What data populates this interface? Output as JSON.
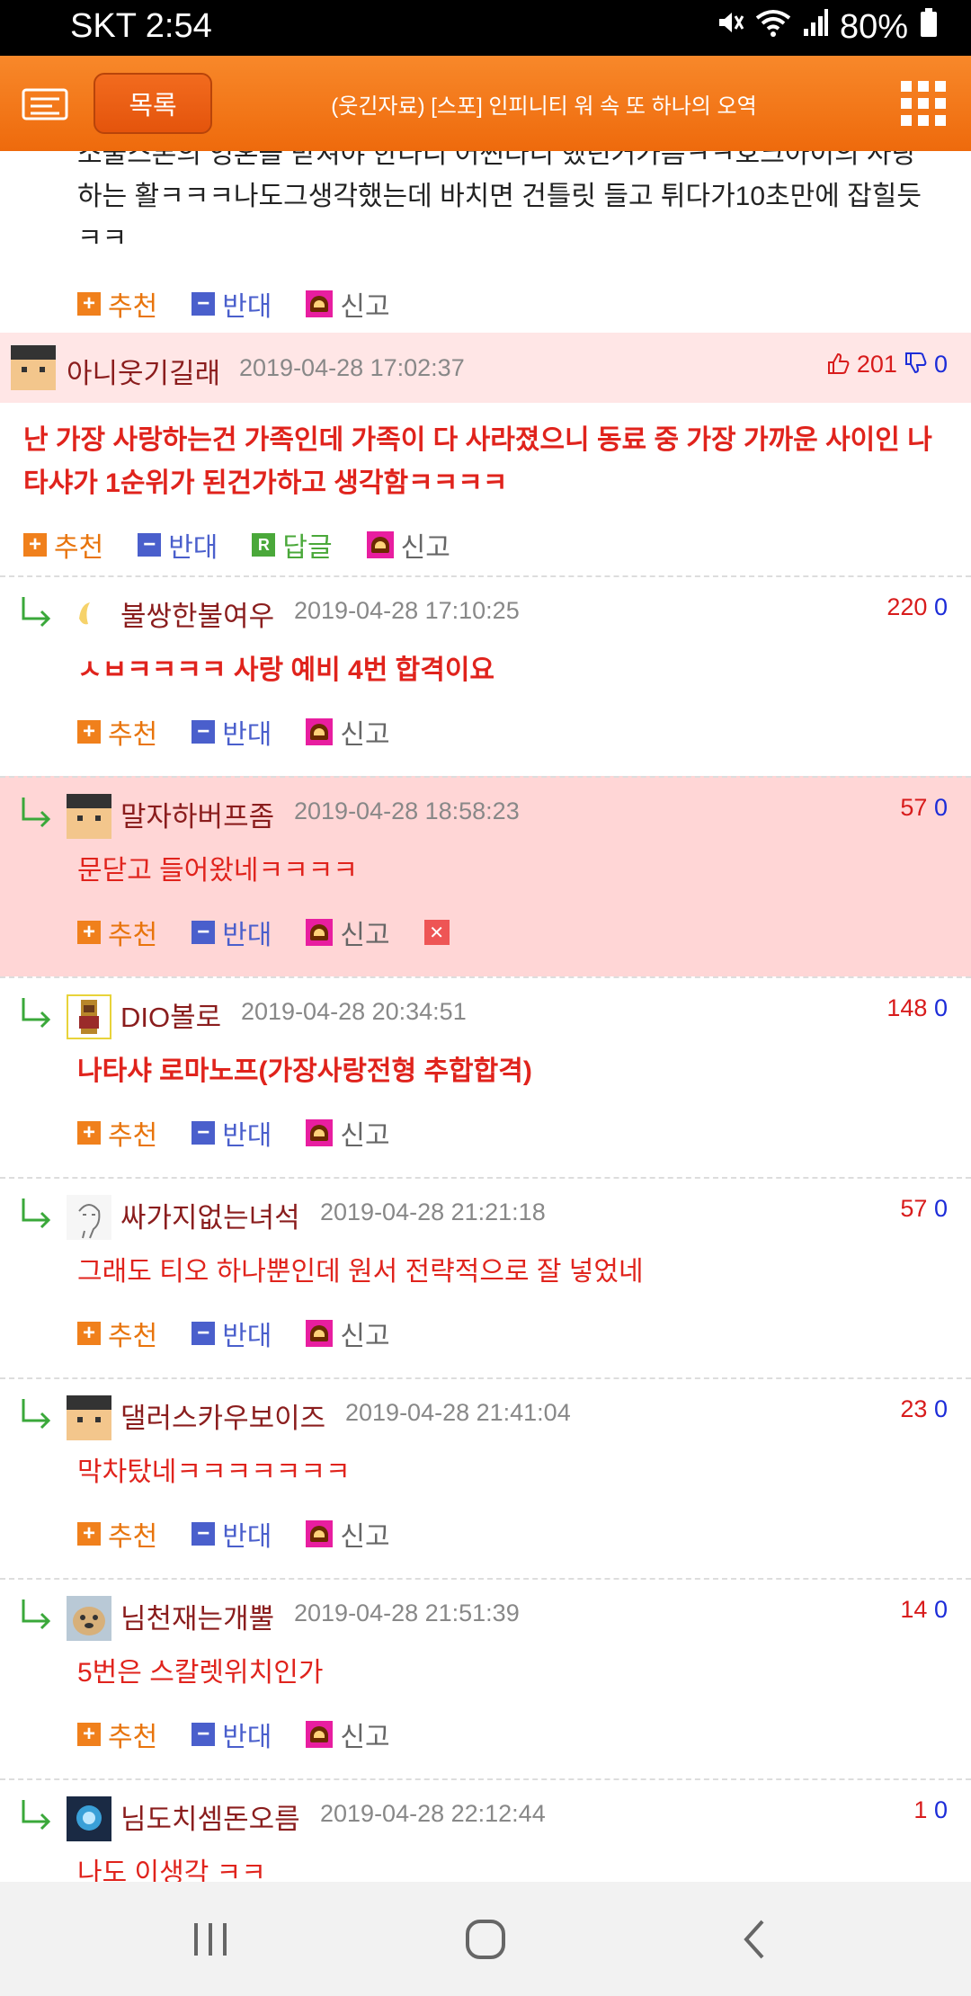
{
  "status_bar": {
    "carrier_time": "SKT 2:54",
    "battery": "80%"
  },
  "header": {
    "list_button": "목록",
    "title": "(웃긴자료) [스포] 인피니티 워 속 또 하나의 오역"
  },
  "top_comment": {
    "text_lines": [
      "소울스톤의 영혼을 받쳐야 한다니 어쩐다니 했던거가틈ㅋㅋ호크아이의 사랑",
      "하는 활ㅋㅋㅋ나도그생각했는데 바치면 건틀릿 들고 튀다가10초만에 잡힐듯",
      "ㅋㅋ"
    ]
  },
  "actions": {
    "recommend": "추천",
    "oppose": "반대",
    "reply": "답글",
    "report": "신고"
  },
  "best_comment": {
    "nickname": "아니웃기길래",
    "date": "2019-04-28 17:02:37",
    "up": "201",
    "down": "0",
    "text_lines": [
      "난 가장 사랑하는건 가족인데 가족이 다 사라졌으니 동료 중 가장 가까운 사이인 나",
      "타샤가 1순위가 된건가하고 생각함ㅋㅋㅋㅋ"
    ]
  },
  "replies": [
    {
      "nickname": "불쌍한불여우",
      "date": "2019-04-28 17:10:25",
      "up": "220",
      "down": "0",
      "text": "ㅅㅂㅋㅋㅋㅋ 사랑 예비 4번 합격이요",
      "bold": true,
      "highlighted": false,
      "avatar": "fox"
    },
    {
      "nickname": "말자하버프좀",
      "date": "2019-04-28 18:58:23",
      "up": "57",
      "down": "0",
      "text": "문닫고 들어왔네ㅋㅋㅋㅋ",
      "bold": false,
      "highlighted": true,
      "avatar": "pixel"
    },
    {
      "nickname": "DIO볼로",
      "date": "2019-04-28 20:34:51",
      "up": "148",
      "down": "0",
      "text": "나타샤 로마노프(가장사랑전형 추합합격)",
      "bold": true,
      "highlighted": false,
      "avatar": "dio"
    },
    {
      "nickname": "싸가지없는녀석",
      "date": "2019-04-28 21:21:18",
      "up": "57",
      "down": "0",
      "text": "그래도 티오 하나뿐인데 원서 전략적으로 잘 넣었네",
      "bold": false,
      "highlighted": false,
      "avatar": "sketch"
    },
    {
      "nickname": "댈러스카우보이즈",
      "date": "2019-04-28 21:41:04",
      "up": "23",
      "down": "0",
      "text": "막차탔네ㅋㅋㅋㅋㅋㅋㅋ",
      "bold": false,
      "highlighted": false,
      "avatar": "pixel"
    },
    {
      "nickname": "님천재는개뿔",
      "date": "2019-04-28 21:51:39",
      "up": "14",
      "down": "0",
      "text": "5번은 스칼렛위치인가",
      "bold": false,
      "highlighted": false,
      "avatar": "dog"
    },
    {
      "nickname": "님도치셈돈오름",
      "date": "2019-04-28 22:12:44",
      "up": "1",
      "down": "0",
      "text": "나도 이생각 ㅋㅋ",
      "bold": false,
      "highlighted": false,
      "avatar": "blue"
    }
  ],
  "colors": {
    "header": "#f07a1e",
    "best_bg": "#ffe6e6",
    "highlight_bg": "#ffd6d6",
    "comment_red": "#e0231c"
  }
}
